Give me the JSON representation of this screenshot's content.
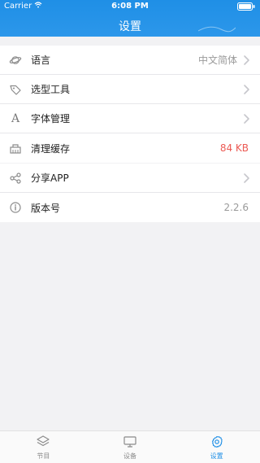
{
  "status": {
    "carrier": "Carrier",
    "time": "6:08 PM"
  },
  "header": {
    "title": "设置"
  },
  "group1": [
    {
      "label": "语言",
      "value": "中文简体",
      "icon": "planet-icon"
    },
    {
      "label": "选型工具",
      "value": "",
      "icon": "tag-icon"
    },
    {
      "label": "字体管理",
      "value": "",
      "icon": "font-icon"
    },
    {
      "label": "清理缓存",
      "value": "84 KB",
      "icon": "cleanup-icon"
    }
  ],
  "group2": [
    {
      "label": "分享APP",
      "value": "",
      "icon": "share-icon"
    },
    {
      "label": "版本号",
      "value": "2.2.6",
      "icon": "info-icon"
    }
  ],
  "tabs": [
    {
      "label": "节目",
      "icon": "layers-icon",
      "active": false
    },
    {
      "label": "设备",
      "icon": "monitor-icon",
      "active": false
    },
    {
      "label": "设置",
      "icon": "gear-icon",
      "active": true
    }
  ],
  "colors": {
    "accent": "#1f8fe6",
    "cache_size": "#ec5a54",
    "muted": "#9a9a9a"
  }
}
